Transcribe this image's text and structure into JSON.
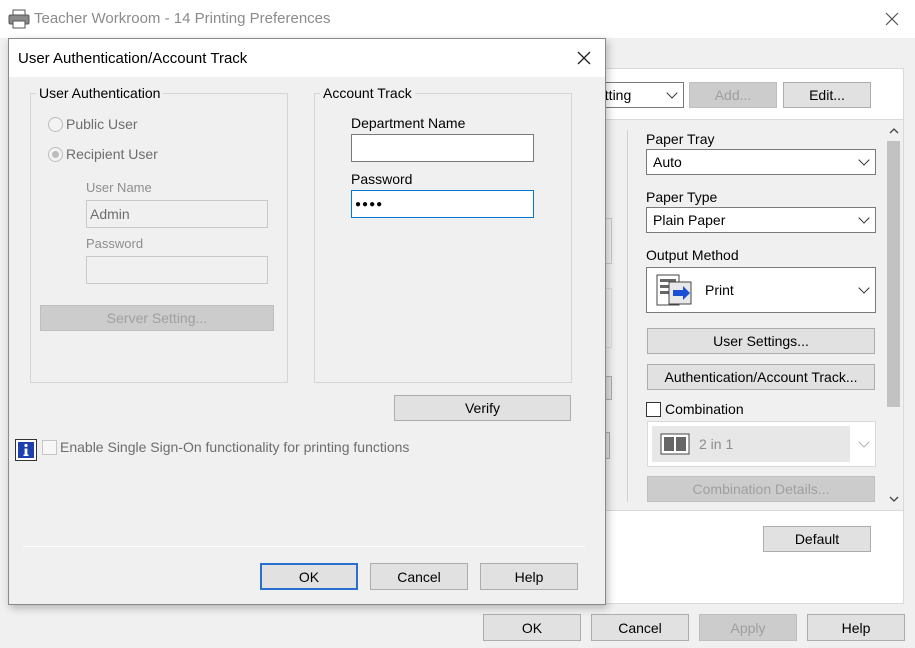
{
  "parent_window": {
    "title": "Teacher Workroom - 14 Printing Preferences",
    "setting_combo_value": "etting",
    "add_label": "Add...",
    "edit_label": "Edit...",
    "paper_tray_label": "Paper Tray",
    "paper_tray_value": "Auto",
    "paper_type_label": "Paper Type",
    "paper_type_value": "Plain Paper",
    "output_method_label": "Output Method",
    "output_method_value": "Print",
    "user_settings_label": "User Settings...",
    "auth_track_label": "Authentication/Account Track...",
    "combination_label": "Combination",
    "combination_value": "2 in 1",
    "combination_details_label": "Combination Details...",
    "default_label": "Default",
    "ok_label": "OK",
    "cancel_label": "Cancel",
    "apply_label": "Apply",
    "help_label": "Help"
  },
  "dialog": {
    "title": "User Authentication/Account Track",
    "user_auth": {
      "group_title": "User Authentication",
      "public_user": "Public User",
      "recipient_user": "Recipient User",
      "user_name_label": "User Name",
      "user_name_value": "Admin",
      "password_label": "Password",
      "password_value": "",
      "server_setting_label": "Server Setting..."
    },
    "account_track": {
      "group_title": "Account Track",
      "department_name_label": "Department Name",
      "department_name_value": "",
      "password_label": "Password",
      "password_value": "●●●●"
    },
    "verify_label": "Verify",
    "sso_label": "Enable Single Sign-On functionality for printing functions",
    "ok_label": "OK",
    "cancel_label": "Cancel",
    "help_label": "Help"
  }
}
